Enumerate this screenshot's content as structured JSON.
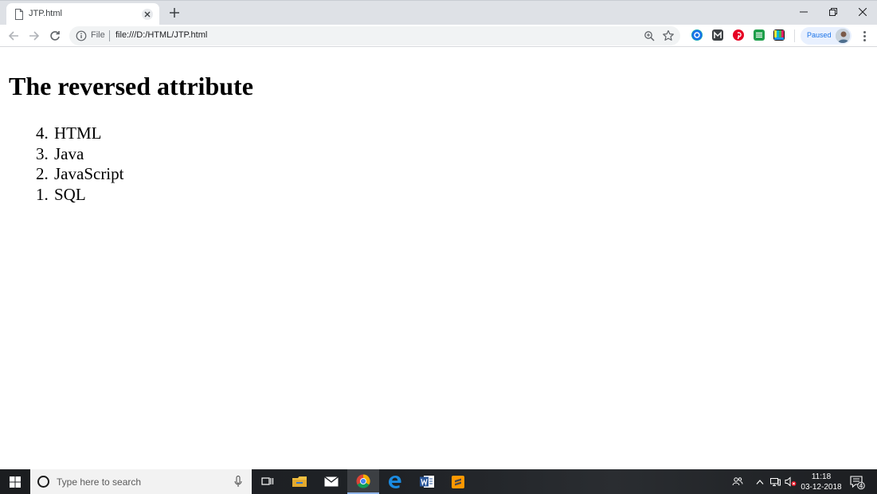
{
  "browser": {
    "tab_title": "JTP.html",
    "scheme_label": "File",
    "url": "file:///D:/HTML/JTP.html",
    "profile_status": "Paused"
  },
  "page": {
    "heading": "The reversed attribute",
    "list": [
      {
        "num": "4.",
        "text": "HTML"
      },
      {
        "num": "3.",
        "text": "Java"
      },
      {
        "num": "2.",
        "text": "JavaScript"
      },
      {
        "num": "1.",
        "text": "SQL"
      }
    ]
  },
  "taskbar": {
    "search_placeholder": "Type here to search",
    "time": "11:18",
    "date": "03-12-2018",
    "notification_count": "4"
  },
  "icons": {
    "extensions": [
      "grammarly-icon",
      "m-extension-icon",
      "pinterest-icon",
      "green-extension-icon",
      "color-bars-extension-icon"
    ],
    "apps": [
      "task-view-icon",
      "file-explorer-icon",
      "mail-icon",
      "chrome-icon",
      "edge-icon",
      "word-icon",
      "sublime-text-icon"
    ]
  },
  "colors": {
    "tabstrip": "#dee1e6",
    "omnibox": "#f1f3f4",
    "paused_bg": "#e8f0fe",
    "paused_text": "#1a73e8",
    "taskbar": "#1f2226"
  }
}
